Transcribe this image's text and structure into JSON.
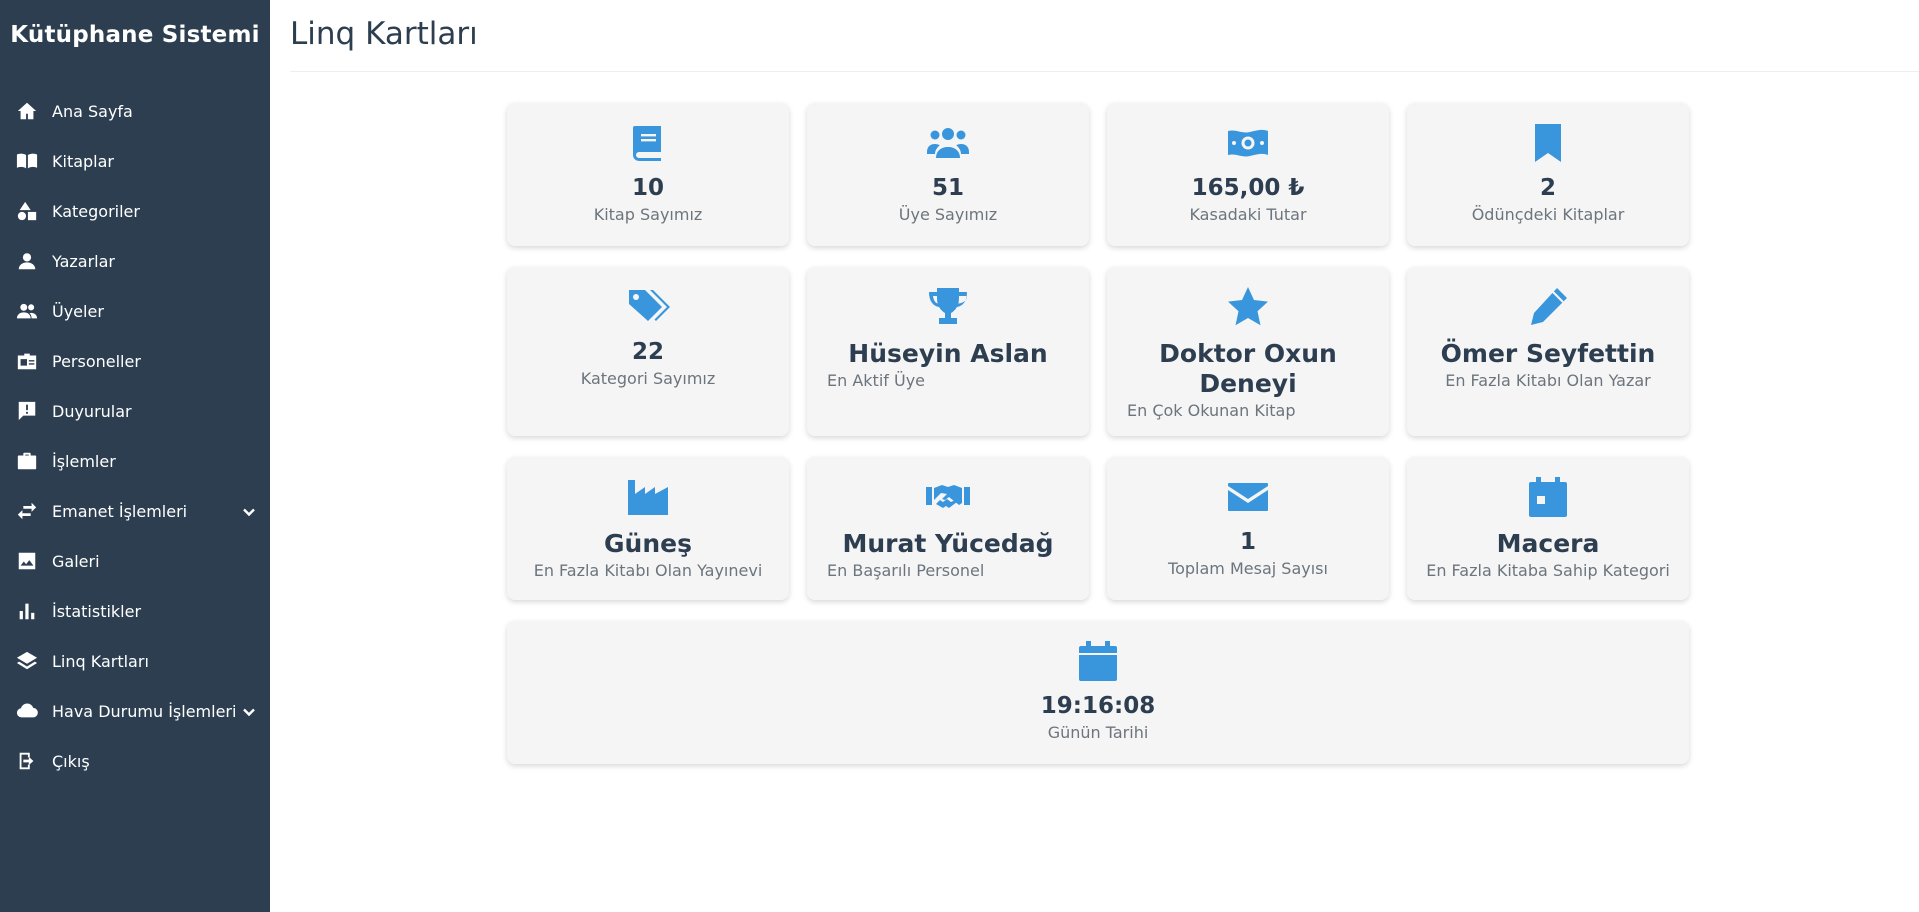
{
  "app": {
    "brand": "Kütüphane Sistemi"
  },
  "sidebar": {
    "items": [
      {
        "label": "Ana Sayfa",
        "icon": "home-icon"
      },
      {
        "label": "Kitaplar",
        "icon": "book-open-icon"
      },
      {
        "label": "Kategoriler",
        "icon": "shapes-icon"
      },
      {
        "label": "Yazarlar",
        "icon": "user-icon"
      },
      {
        "label": "Üyeler",
        "icon": "users-icon"
      },
      {
        "label": "Personeller",
        "icon": "id-badge-icon"
      },
      {
        "label": "Duyurular",
        "icon": "comment-alert-icon"
      },
      {
        "label": "İşlemler",
        "icon": "briefcase-icon"
      },
      {
        "label": "Emanet İşlemleri",
        "icon": "exchange-icon",
        "has_submenu": true
      },
      {
        "label": "Galeri",
        "icon": "image-icon"
      },
      {
        "label": "İstatistikler",
        "icon": "bar-chart-icon"
      },
      {
        "label": "Linq Kartları",
        "icon": "layers-icon"
      },
      {
        "label": "Hava Durumu İşlemleri",
        "icon": "cloud-icon",
        "has_submenu": true
      },
      {
        "label": "Çıkış",
        "icon": "sign-out-icon"
      }
    ]
  },
  "page": {
    "title": "Linq Kartları"
  },
  "cards": [
    {
      "icon": "book-icon",
      "value": "10",
      "label": "Kitap Sayımız"
    },
    {
      "icon": "users-icon",
      "value": "51",
      "label": "Üye Sayımız"
    },
    {
      "icon": "money-bill-icon",
      "value": "165,00 ₺",
      "label": "Kasadaki Tutar"
    },
    {
      "icon": "bookmark-icon",
      "value": "2",
      "label": "Ödünçdeki Kitaplar"
    },
    {
      "icon": "tags-icon",
      "value": "22",
      "label": "Kategori Sayımız"
    },
    {
      "icon": "trophy-icon",
      "value": "Hüseyin Aslan",
      "label": "En Aktif Üye"
    },
    {
      "icon": "star-icon",
      "value": "Doktor Oxun Deneyi",
      "label": "En Çok Okunan Kitap"
    },
    {
      "icon": "pencil-icon",
      "value": "Ömer Seyfettin",
      "label": "En Fazla Kitabı Olan Yazar"
    },
    {
      "icon": "industry-icon",
      "value": "Güneş",
      "label": "En Fazla Kitabı Olan Yayınevi"
    },
    {
      "icon": "handshake-icon",
      "value": "Murat Yücedağ",
      "label": "En Başarılı Personel"
    },
    {
      "icon": "envelope-icon",
      "value": "1",
      "label": "Toplam Mesaj Sayısı"
    },
    {
      "icon": "calendar-icon",
      "value": "Macera",
      "label": "En Fazla Kitaba Sahip Kategori"
    },
    {
      "icon": "calendar-icon",
      "value": "19:16:08",
      "label": "Günün Tarihi"
    }
  ],
  "colors": {
    "sidebar_bg": "#2c3e50",
    "accent": "#3a96dc",
    "card_bg": "#f5f5f5"
  }
}
